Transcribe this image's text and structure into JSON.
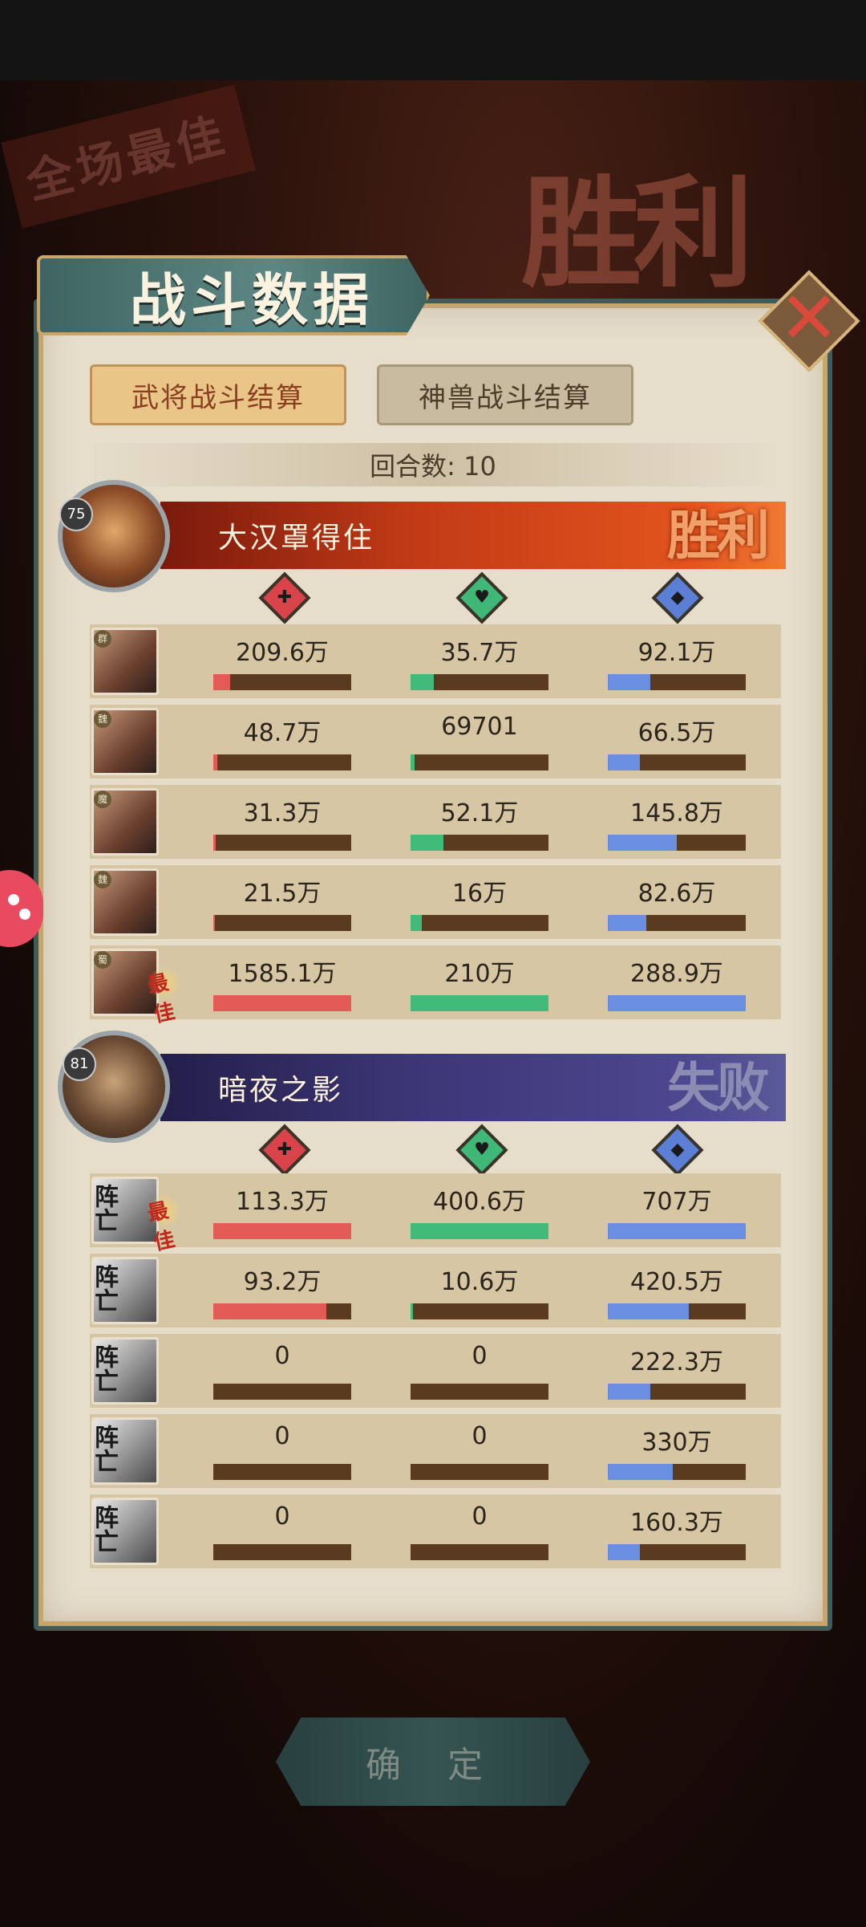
{
  "background": {
    "best_label": "全场最佳",
    "result_label": "胜利"
  },
  "title": "战斗数据",
  "tabs": [
    {
      "label": "武将战斗结算",
      "active": true
    },
    {
      "label": "神兽战斗结算",
      "active": false
    }
  ],
  "rounds_label": "回合数: 10",
  "stat_icons": {
    "damage": "damage-icon",
    "heal": "heal-icon",
    "defense": "defense-icon"
  },
  "colors": {
    "damage": "#e35a57",
    "heal": "#41bb79",
    "defense": "#6a8ee0",
    "win": "#c13a16",
    "lose": "#3c3676"
  },
  "teams": [
    {
      "name": "大汉罩得住",
      "level": "75",
      "result": "胜利",
      "heroes": [
        {
          "faction": "群",
          "best": false,
          "dead": false,
          "damage": "209.6万",
          "damage_pct": 0.12,
          "heal": "35.7万",
          "heal_pct": 0.17,
          "defense": "92.1万",
          "defense_pct": 0.31
        },
        {
          "faction": "魏",
          "best": false,
          "dead": false,
          "damage": "48.7万",
          "damage_pct": 0.03,
          "heal": "69701",
          "heal_pct": 0.03,
          "defense": "66.5万",
          "defense_pct": 0.23
        },
        {
          "faction": "魔",
          "best": false,
          "dead": false,
          "damage": "31.3万",
          "damage_pct": 0.02,
          "heal": "52.1万",
          "heal_pct": 0.24,
          "defense": "145.8万",
          "defense_pct": 0.5
        },
        {
          "faction": "魏",
          "best": false,
          "dead": false,
          "damage": "21.5万",
          "damage_pct": 0.01,
          "heal": "16万",
          "heal_pct": 0.08,
          "defense": "82.6万",
          "defense_pct": 0.28
        },
        {
          "faction": "蜀",
          "best": true,
          "dead": false,
          "damage": "1585.1万",
          "damage_pct": 1.0,
          "heal": "210万",
          "heal_pct": 1.0,
          "defense": "288.9万",
          "defense_pct": 1.0
        }
      ]
    },
    {
      "name": "暗夜之影",
      "level": "81",
      "result": "失败",
      "heroes": [
        {
          "faction": "",
          "best": true,
          "dead": true,
          "damage": "113.3万",
          "damage_pct": 1.0,
          "heal": "400.6万",
          "heal_pct": 1.0,
          "defense": "707万",
          "defense_pct": 1.0
        },
        {
          "faction": "",
          "best": false,
          "dead": true,
          "damage": "93.2万",
          "damage_pct": 0.82,
          "heal": "10.6万",
          "heal_pct": 0.02,
          "defense": "420.5万",
          "defense_pct": 0.59
        },
        {
          "faction": "",
          "best": false,
          "dead": true,
          "damage": "0",
          "damage_pct": 0,
          "heal": "0",
          "heal_pct": 0,
          "defense": "222.3万",
          "defense_pct": 0.31
        },
        {
          "faction": "",
          "best": false,
          "dead": true,
          "damage": "0",
          "damage_pct": 0,
          "heal": "0",
          "heal_pct": 0,
          "defense": "330万",
          "defense_pct": 0.47
        },
        {
          "faction": "",
          "best": false,
          "dead": true,
          "damage": "0",
          "damage_pct": 0,
          "heal": "0",
          "heal_pct": 0,
          "defense": "160.3万",
          "defense_pct": 0.23
        }
      ]
    }
  ],
  "dead_label": "阵亡",
  "best_badge": "最佳",
  "confirm_label": "确 定"
}
